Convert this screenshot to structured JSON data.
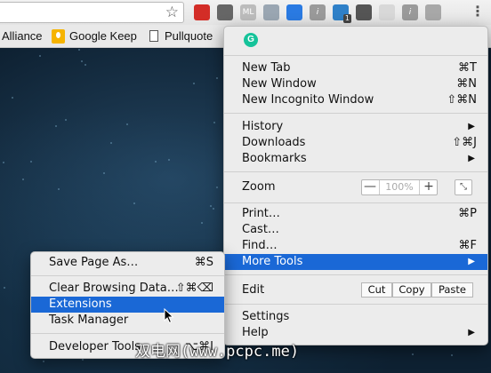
{
  "toolbar": {
    "extension_icons": [
      {
        "name": "lastpass-icon",
        "color": "#d32d27"
      },
      {
        "name": "pocket-icon",
        "color": "#666666"
      },
      {
        "name": "ml-icon",
        "color": "#bcbcbc",
        "text": "ML"
      },
      {
        "name": "puzzle-icon",
        "color": "#9aa6b2"
      },
      {
        "name": "momentum-icon",
        "color": "#2a7ae2"
      },
      {
        "name": "italic-icon",
        "color": "#9a9a9a",
        "text": "i"
      },
      {
        "name": "skype-icon",
        "color": "#2f80c8",
        "badge": "1"
      },
      {
        "name": "onetab-icon",
        "color": "#555555"
      },
      {
        "name": "save-icon",
        "color": "#d8d8d8"
      },
      {
        "name": "italic-icon-2",
        "color": "#9a9a9a",
        "text": "i"
      },
      {
        "name": "gamepad-icon",
        "color": "#a8a8a8"
      }
    ]
  },
  "bookmarks": [
    {
      "name": "bookmark-alliance",
      "label": "Alliance"
    },
    {
      "name": "bookmark-google-keep",
      "label": "Google Keep"
    },
    {
      "name": "bookmark-pullquote",
      "label": "Pullquote"
    }
  ],
  "main_menu": {
    "grammarly_icon": "G",
    "new_tab": {
      "label": "New Tab",
      "shortcut": "⌘T"
    },
    "new_window": {
      "label": "New Window",
      "shortcut": "⌘N"
    },
    "new_incognito": {
      "label": "New Incognito Window",
      "shortcut": "⇧⌘N"
    },
    "history": {
      "label": "History"
    },
    "downloads": {
      "label": "Downloads",
      "shortcut": "⇧⌘J"
    },
    "bookmarks": {
      "label": "Bookmarks"
    },
    "zoom": {
      "label": "Zoom",
      "value": "100%",
      "minus": "—",
      "plus": "+",
      "fullscreen": "⤡"
    },
    "print": {
      "label": "Print…",
      "shortcut": "⌘P"
    },
    "cast": {
      "label": "Cast…"
    },
    "find": {
      "label": "Find…",
      "shortcut": "⌘F"
    },
    "more_tools": {
      "label": "More Tools"
    },
    "edit": {
      "label": "Edit",
      "cut": "Cut",
      "copy": "Copy",
      "paste": "Paste"
    },
    "settings": {
      "label": "Settings"
    },
    "help": {
      "label": "Help"
    }
  },
  "more_tools_menu": {
    "save_page": {
      "label": "Save Page As…",
      "shortcut": "⌘S"
    },
    "clear_data": {
      "label": "Clear Browsing Data…",
      "shortcut": "⇧⌘⌫"
    },
    "extensions": {
      "label": "Extensions"
    },
    "task_manager": {
      "label": "Task Manager"
    },
    "developer_tools": {
      "label": "Developer Tools",
      "shortcut": "⌥⌘I"
    }
  },
  "watermark": "双电网(www.pcpc.me)",
  "colors": {
    "highlight": "#1a68d6",
    "menu_bg": "#ececec"
  }
}
